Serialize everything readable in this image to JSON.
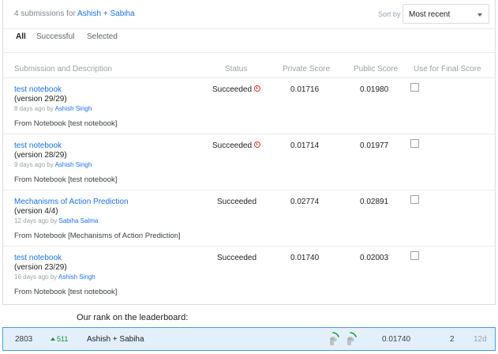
{
  "header": {
    "count_prefix": "4 submissions for",
    "team": "Ashish + Sabiha",
    "sort_label": "Sort by",
    "sort_value": "Most recent"
  },
  "tabs": [
    {
      "label": "All",
      "active": true
    },
    {
      "label": "Successful",
      "active": false
    },
    {
      "label": "Selected",
      "active": false
    }
  ],
  "columns": {
    "submission": "Submission and Description",
    "status": "Status",
    "private": "Private Score",
    "public": "Public Score",
    "final": "Use for Final Score"
  },
  "submissions": [
    {
      "title": "test notebook",
      "version": "(version 29/29)",
      "age": "8 days ago by",
      "author": "Ashish Singh",
      "source": "From Notebook [test notebook]",
      "status": "Succeeded",
      "warning": true,
      "private_score": "0.01716",
      "public_score": "0.01980",
      "use_for_final": false
    },
    {
      "title": "test notebook",
      "version": "(version 28/29)",
      "age": "9 days ago by",
      "author": "Ashish Singh",
      "source": "From Notebook [test notebook]",
      "status": "Succeeded",
      "warning": true,
      "private_score": "0.01714",
      "public_score": "0.01977",
      "use_for_final": false
    },
    {
      "title": "Mechanisms of Action Prediction",
      "version": "(version 4/4)",
      "age": "12 days ago by",
      "author": "Sabiha Salma",
      "source": "From Notebook [Mechanisms of Action Prediction]",
      "status": "Succeeded",
      "warning": false,
      "private_score": "0.02774",
      "public_score": "0.02891",
      "use_for_final": false
    },
    {
      "title": "test notebook",
      "version": "(version 23/29)",
      "age": "16 days ago by",
      "author": "Ashish Singh",
      "source": "From Notebook [test notebook]",
      "status": "Succeeded",
      "warning": false,
      "private_score": "0.01740",
      "public_score": "0.02003",
      "use_for_final": false
    }
  ],
  "leaderboard": {
    "caption": "Our rank on the leaderboard:",
    "rank": "2803",
    "delta": "511",
    "team": "Ashish + Sabiha",
    "avatars": [
      "user-avatar-icon",
      "user-avatar-icon"
    ],
    "score": "0.01740",
    "entries": "2",
    "last": "12d"
  },
  "colors": {
    "link": "#1a73e8",
    "warning": "#d93025",
    "rank_up": "#1e8e3e",
    "highlight_bg": "#e3f0fb",
    "highlight_border": "#4a9be0"
  }
}
